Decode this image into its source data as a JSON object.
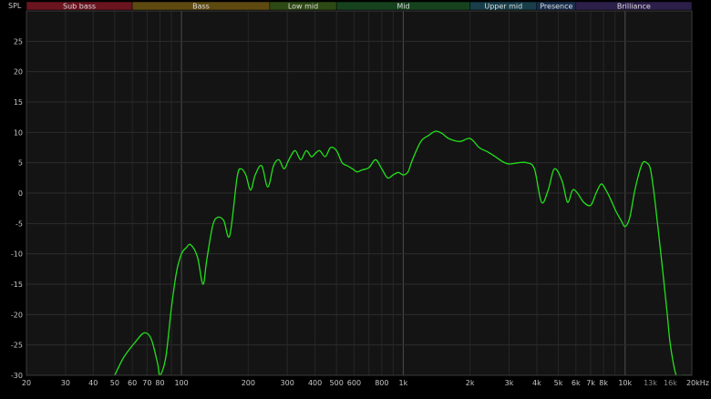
{
  "chart_data": {
    "type": "line",
    "ylabel": "SPL",
    "ylim": [
      -30,
      30
    ],
    "xlim": [
      20,
      20000
    ],
    "x_scale": "log",
    "grid": true,
    "line_color": "#22e01a",
    "y_ticks": [
      "25",
      "20",
      "15",
      "10",
      "5",
      "0",
      "-5",
      "-10",
      "-15",
      "-20",
      "-25",
      "-30"
    ],
    "y_tick_values": [
      25,
      20,
      15,
      10,
      5,
      0,
      -5,
      -10,
      -15,
      -20,
      -25,
      -30
    ],
    "x_ticks": [
      {
        "label": "20",
        "value": 20
      },
      {
        "label": "30",
        "value": 30
      },
      {
        "label": "40",
        "value": 40
      },
      {
        "label": "50",
        "value": 50
      },
      {
        "label": "60",
        "value": 60
      },
      {
        "label": "70",
        "value": 70
      },
      {
        "label": "80",
        "value": 80
      },
      {
        "label": "100",
        "value": 100
      },
      {
        "label": "200",
        "value": 200
      },
      {
        "label": "300",
        "value": 300
      },
      {
        "label": "400",
        "value": 400
      },
      {
        "label": "500",
        "value": 500
      },
      {
        "label": "600",
        "value": 600
      },
      {
        "label": "800",
        "value": 800
      },
      {
        "label": "1k",
        "value": 1000
      },
      {
        "label": "2k",
        "value": 2000
      },
      {
        "label": "3k",
        "value": 3000
      },
      {
        "label": "4k",
        "value": 4000
      },
      {
        "label": "5k",
        "value": 5000
      },
      {
        "label": "6k",
        "value": 6000
      },
      {
        "label": "7k",
        "value": 7000
      },
      {
        "label": "8k",
        "value": 8000
      },
      {
        "label": "10k",
        "value": 10000
      },
      {
        "label": "13k",
        "value": 13000,
        "dim": true
      },
      {
        "label": "16k",
        "value": 16000,
        "dim": true
      },
      {
        "label": "20kHz",
        "value": 20000
      }
    ],
    "bands": [
      {
        "label": "Sub bass",
        "from": 20,
        "to": 60,
        "color": "#6a1420"
      },
      {
        "label": "Bass",
        "from": 60,
        "to": 250,
        "color": "#5e4a10"
      },
      {
        "label": "Low mid",
        "from": 250,
        "to": 500,
        "color": "#2e4a14"
      },
      {
        "label": "Mid",
        "from": 500,
        "to": 2000,
        "color": "#16431e"
      },
      {
        "label": "Upper mid",
        "from": 2000,
        "to": 4000,
        "color": "#173e4a"
      },
      {
        "label": "Presence",
        "from": 4000,
        "to": 6000,
        "color": "#1a2f4e"
      },
      {
        "label": "Brilliance",
        "from": 6000,
        "to": 20000,
        "color": "#2c1f4a"
      }
    ],
    "series": [
      {
        "x": [
          50,
          55,
          62,
          68,
          73,
          78,
          80,
          85,
          90,
          95,
          100,
          105,
          110,
          118,
          125,
          130,
          138,
          145,
          155,
          165,
          178,
          185,
          195,
          205,
          215,
          230,
          245,
          260,
          275,
          290,
          305,
          325,
          345,
          365,
          385,
          400,
          420,
          445,
          470,
          500,
          530,
          560,
          590,
          620,
          650,
          700,
          750,
          800,
          850,
          900,
          950,
          1000,
          1050,
          1100,
          1200,
          1300,
          1400,
          1500,
          1600,
          1800,
          2000,
          2200,
          2400,
          2600,
          2800,
          3000,
          3300,
          3600,
          3900,
          4200,
          4500,
          4800,
          5200,
          5500,
          5800,
          6100,
          6500,
          7000,
          7400,
          7800,
          8200,
          8600,
          9100,
          9600,
          10000,
          10500,
          11000,
          11500,
          12000,
          12500,
          13000,
          13500,
          14000,
          14500,
          15000,
          15500,
          16000,
          17000,
          18000,
          19000,
          20000
        ],
        "y": [
          -30,
          -27,
          -24.5,
          -23,
          -24,
          -28,
          -30,
          -27,
          -19,
          -13,
          -10,
          -9,
          -8.5,
          -10.5,
          -15,
          -11,
          -5.5,
          -4,
          -4.5,
          -7,
          2.5,
          4,
          3,
          0.5,
          3,
          4.5,
          1,
          4.5,
          5.5,
          4,
          5.5,
          7,
          5.5,
          7,
          6,
          6.5,
          7,
          6,
          7.5,
          7,
          5,
          4.5,
          4,
          3.5,
          3.8,
          4.2,
          5.5,
          4,
          2.5,
          3,
          3.4,
          3,
          3.5,
          5.5,
          8.5,
          9.5,
          10.2,
          9.8,
          9,
          8.5,
          9,
          7.5,
          6.8,
          6,
          5.2,
          4.8,
          5,
          5,
          4,
          -1.5,
          0.5,
          4,
          2,
          -1.5,
          0.5,
          0,
          -1.5,
          -2,
          0,
          1.5,
          0.5,
          -1,
          -3,
          -4.5,
          -5.5,
          -4,
          0,
          3,
          5,
          5,
          4,
          0,
          -5,
          -10,
          -15,
          -20,
          -25,
          -30,
          -30,
          -30,
          -30
        ]
      }
    ]
  }
}
